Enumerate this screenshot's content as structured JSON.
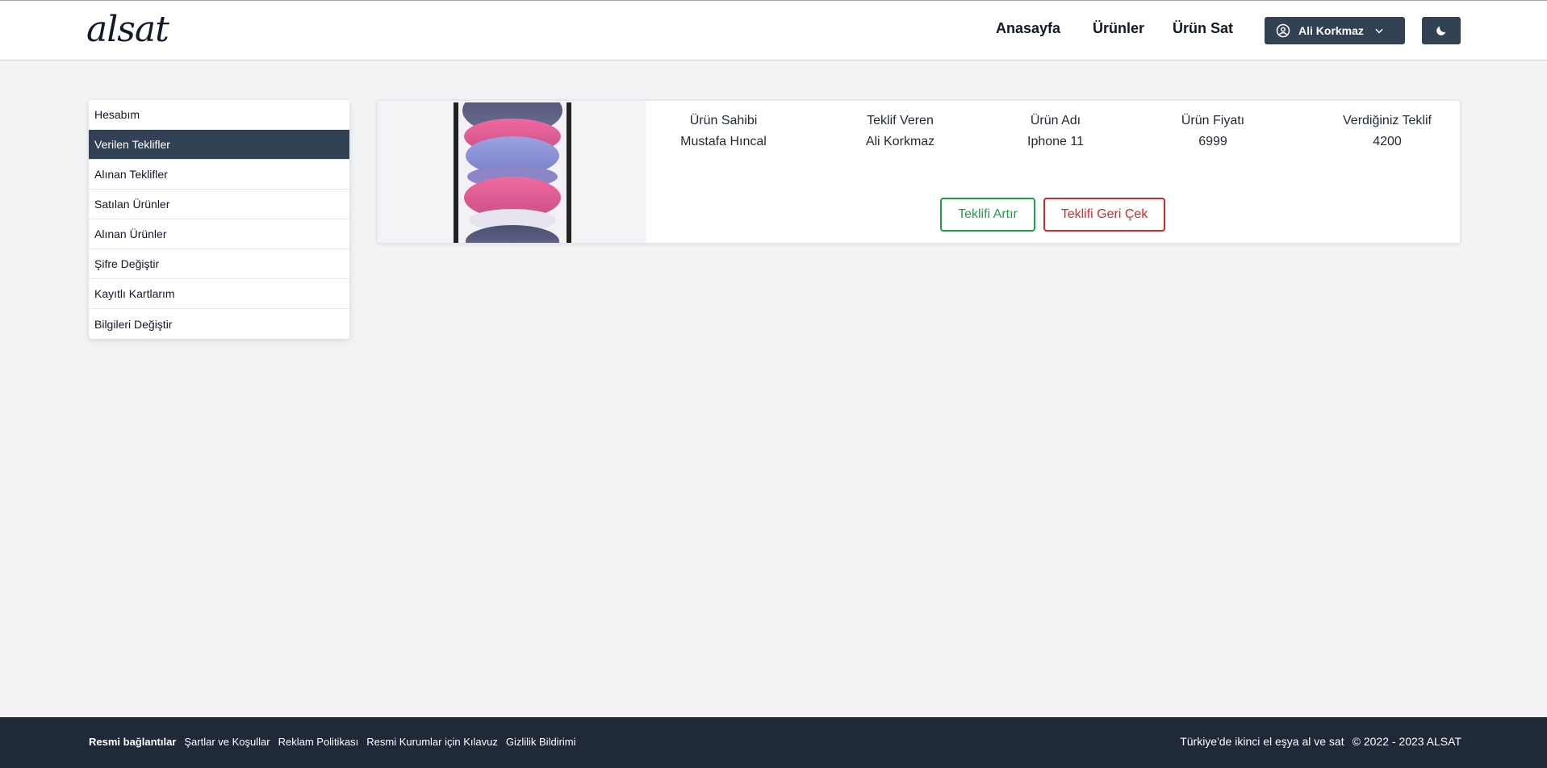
{
  "header": {
    "logo": "alsat",
    "nav": {
      "home": "Anasayfa",
      "products": "Ürünler",
      "sell": "Ürün Sat"
    },
    "user_name": "Ali Korkmaz"
  },
  "sidebar": {
    "items": [
      {
        "label": "Hesabım",
        "active": false
      },
      {
        "label": "Verilen Teklifler",
        "active": true
      },
      {
        "label": "Alınan Teklifler",
        "active": false
      },
      {
        "label": "Satılan Ürünler",
        "active": false
      },
      {
        "label": "Alınan Ürünler",
        "active": false
      },
      {
        "label": "Şifre Değiştir",
        "active": false
      },
      {
        "label": "Kayıtlı Kartlarım",
        "active": false
      },
      {
        "label": "Bilgileri Değiştir",
        "active": false
      }
    ]
  },
  "offer": {
    "columns": [
      {
        "header": "Ürün Sahibi",
        "value": "Mustafa Hıncal"
      },
      {
        "header": "Teklif Veren",
        "value": "Ali Korkmaz"
      },
      {
        "header": "Ürün Adı",
        "value": "Iphone 11"
      },
      {
        "header": "Ürün Fiyatı",
        "value": "6999"
      },
      {
        "header": "Verdiğiniz Teklif",
        "value": "4200"
      }
    ],
    "raise_label": "Teklifi Artır",
    "withdraw_label": "Teklifi Geri Çek"
  },
  "footer": {
    "links_title": "Resmi bağlantılar",
    "links": [
      "Şartlar ve Koşullar",
      "Reklam Politikası",
      "Resmi Kurumlar için Kılavuz",
      "Gizlilik Bildirimi"
    ],
    "tagline": "Türkiye'de ikinci el eşya al ve sat",
    "copyright": "© 2022 - 2023 ALSAT"
  },
  "colors": {
    "dark": "#334155",
    "footer": "#1f2937",
    "green": "#16a34a",
    "red": "#dc2626"
  },
  "icons": [
    "user-circle-icon",
    "chevron-down-icon",
    "moon-icon"
  ]
}
